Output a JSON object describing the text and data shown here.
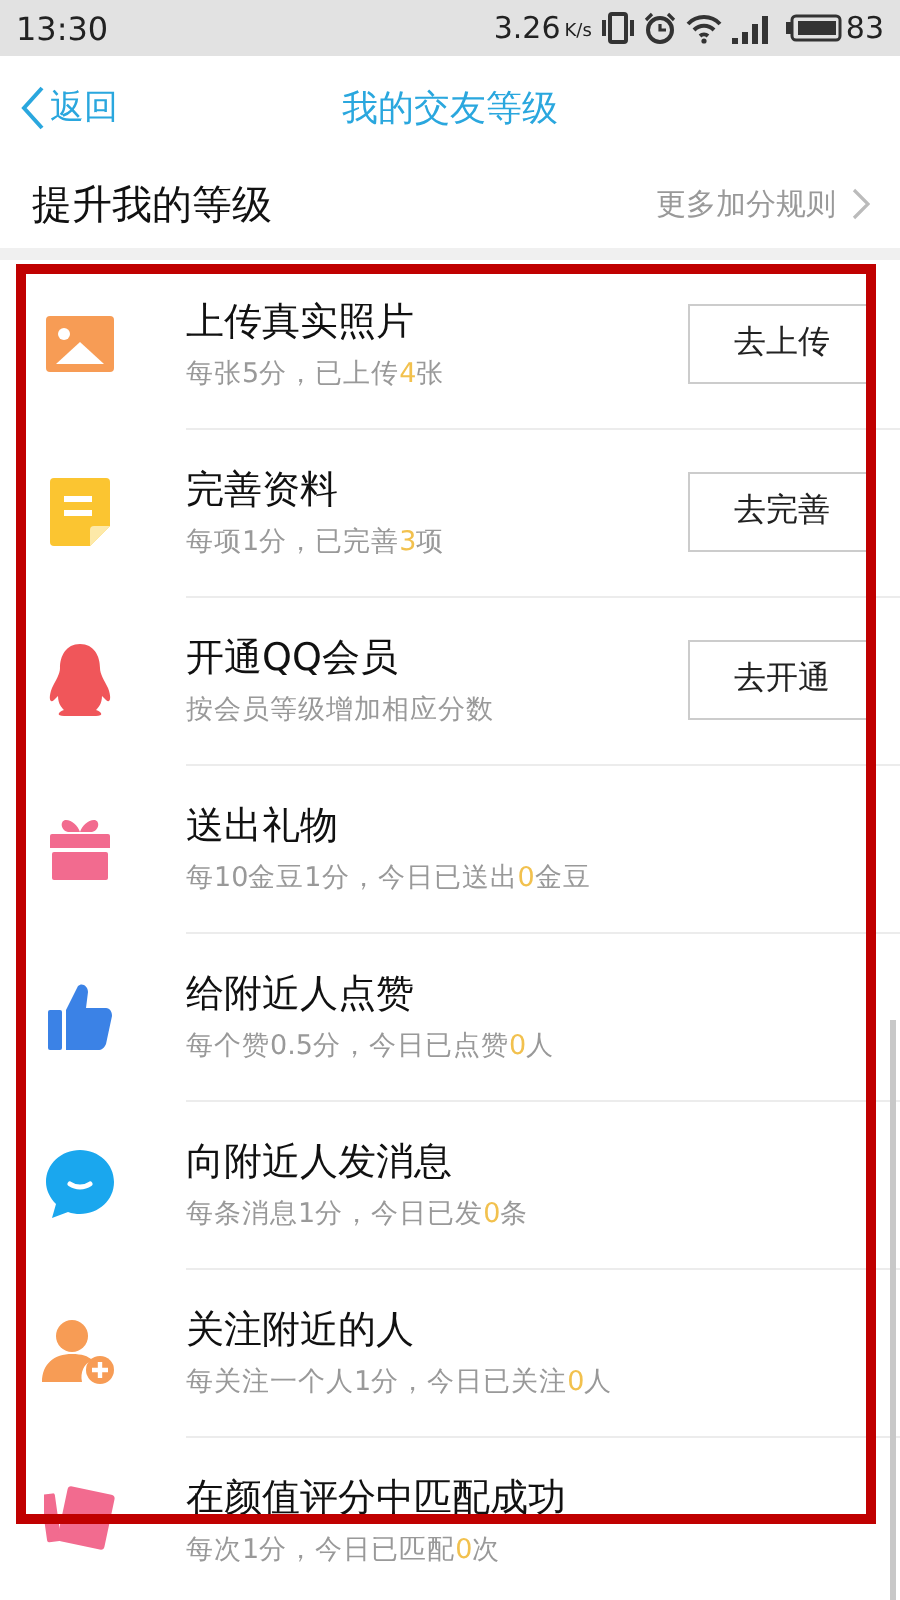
{
  "status_bar": {
    "time": "13:30",
    "speed": "3.26",
    "speed_unit": "K/s",
    "battery": "83"
  },
  "nav": {
    "back": "返回",
    "title": "我的交友等级"
  },
  "section": {
    "title": "提升我的等级",
    "link": "更多加分规则"
  },
  "rows": [
    {
      "kind": "photo",
      "title": "上传真实照片",
      "desc": "每张5分，已上传",
      "count": "4",
      "unit": "张",
      "button": "去上传"
    },
    {
      "kind": "note",
      "title": "完善资料",
      "desc": "每项1分，已完善",
      "count": "3",
      "unit": "项",
      "button": "去完善"
    },
    {
      "kind": "penguin",
      "title": "开通QQ会员",
      "desc": "按会员等级增加相应分数",
      "button": "去开通"
    },
    {
      "kind": "gift",
      "title": "送出礼物",
      "desc": "每10金豆1分，今日已送出",
      "count": "0",
      "unit": "金豆"
    },
    {
      "kind": "thumb",
      "title": "给附近人点赞",
      "desc": "每个赞0.5分，今日已点赞",
      "count": "0",
      "unit": "人"
    },
    {
      "kind": "chat",
      "title": "向附近人发消息",
      "desc": "每条消息1分，今日已发",
      "count": "0",
      "unit": "条"
    },
    {
      "kind": "person",
      "title": "关注附近的人",
      "desc": "每关注一个人1分，今日已关注",
      "count": "0",
      "unit": "人"
    },
    {
      "kind": "cards",
      "title": "在颜值评分中匹配成功",
      "desc": "每次1分，今日已匹配",
      "count": "0",
      "unit": "次"
    }
  ]
}
